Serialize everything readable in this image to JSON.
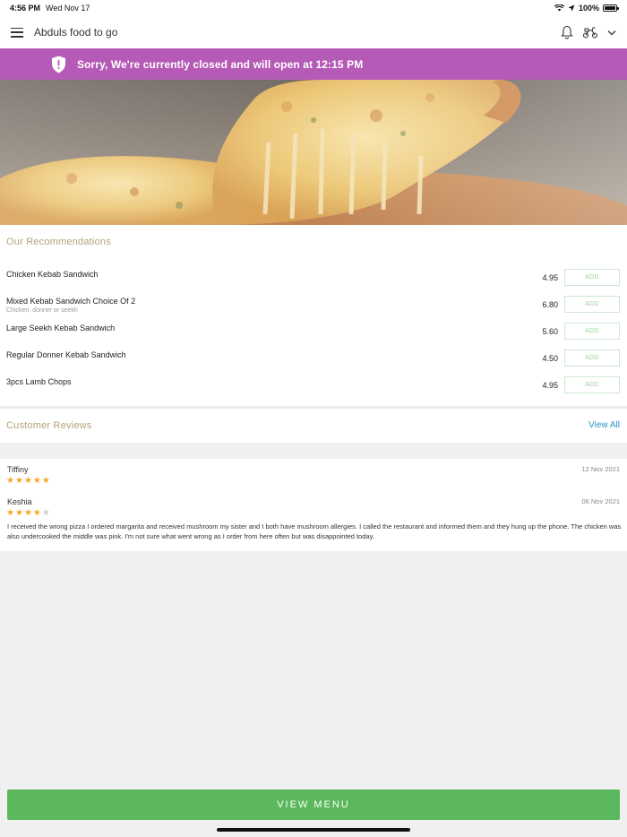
{
  "status_bar": {
    "time": "4:56 PM",
    "date": "Wed Nov 17",
    "battery": "100%"
  },
  "header": {
    "title": "Abduls food to go"
  },
  "banner": {
    "message": "Sorry, We're currently closed and will open at 12:15 PM",
    "color": "#b65ab7"
  },
  "recommendations": {
    "title": "Our Recommendations",
    "add_label": "ADD",
    "items": [
      {
        "name": "Chicken Kebab Sandwich",
        "desc": "",
        "price": "4.95"
      },
      {
        "name": "Mixed Kebab Sandwich Choice Of 2",
        "desc": "Chicken, donner or seekh",
        "price": "6.80"
      },
      {
        "name": "Large Seekh Kebab Sandwich",
        "desc": "",
        "price": "5.60"
      },
      {
        "name": "Regular Donner Kebab Sandwich",
        "desc": "",
        "price": "4.50"
      },
      {
        "name": "3pcs Lamb Chops",
        "desc": "",
        "price": "4.95"
      }
    ]
  },
  "reviews": {
    "title": "Customer Reviews",
    "view_all": "View All",
    "items": [
      {
        "author": "Tiffiny",
        "date": "12 Nov 2021",
        "rating": 5,
        "body": ""
      },
      {
        "author": "Keshia",
        "date": "06 Nov 2021",
        "rating": 4,
        "body": "I received the wrong pizza I ordered margarita and received mushroom my sister and I both have mushroom allergies. I called the restaurant and informed them and they hung up the phone. The chicken was also undercooked the middle was pink. I'm not sure what went wrong as I order from here often but was disappointed today."
      }
    ]
  },
  "footer": {
    "view_menu": "VIEW MENU",
    "button_color": "#5cb85c"
  },
  "icons": {
    "menu": "hamburger-menu-icon",
    "bell": "bell-icon",
    "scooter": "delivery-scooter-icon",
    "chevron": "chevron-down-icon",
    "shield": "shield-alert-icon"
  }
}
